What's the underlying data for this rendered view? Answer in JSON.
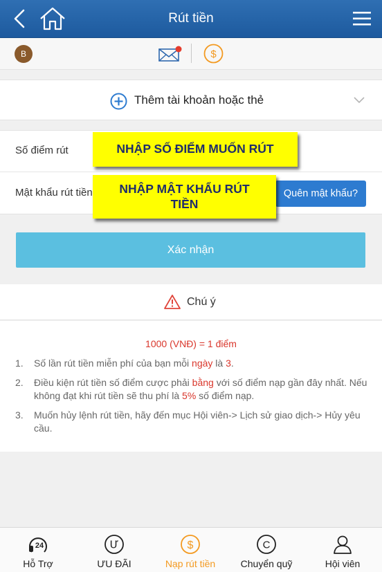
{
  "header": {
    "title": "Rút tiền"
  },
  "user": {
    "avatar_letter": "B"
  },
  "add_account": {
    "label": "Thêm tài khoản hoặc thẻ"
  },
  "form": {
    "points_label": "Số điểm rút",
    "points_value": "",
    "password_label": "Mật khẩu rút tiền",
    "password_value": "",
    "forgot_label": "Quên mật khẩu?"
  },
  "annotations": {
    "points_note": "NHẬP SỐ ĐIỂM MUỐN RÚT",
    "password_note_line1": "NHẬP MẬT KHẨU RÚT",
    "password_note_line2": "TIỀN"
  },
  "confirm": {
    "label": "Xác nhận"
  },
  "notice": {
    "title": "Chú ý",
    "rate": "1000 (VNĐ) = 1 điểm",
    "rules": [
      {
        "num": "1.",
        "p1": "Số lần rút tiền miễn phí của bạn mỗi ",
        "h1": "ngày",
        "p2": " là ",
        "h2": "3",
        "p3": "."
      },
      {
        "num": "2.",
        "p1": "Điều kiện rút tiền số điểm cược phải ",
        "h1": "bằng",
        "p2": " với số điểm nạp gần đây nhất. Nếu không đạt khi rút tiền sẽ thu phí là ",
        "h2": "5%",
        "p3": " số điểm nạp."
      },
      {
        "num": "3.",
        "p1": "Muốn hủy lệnh rút tiền, hãy đến mục Hội viên-> Lịch sử giao dịch-> Hủy yêu cầu."
      }
    ]
  },
  "tabs": [
    {
      "label": "Hỗ Trợ",
      "icon": "support-24-icon"
    },
    {
      "label": "ƯU ĐÃI",
      "icon": "promotion-icon"
    },
    {
      "label": "Nạp rút tiền",
      "icon": "deposit-withdraw-icon",
      "active": true
    },
    {
      "label": "Chuyển quỹ",
      "icon": "transfer-icon"
    },
    {
      "label": "Hội viên",
      "icon": "member-icon"
    }
  ],
  "colors": {
    "header": "#2f6fb3",
    "accent": "#5bbfe0",
    "button_blue": "#2d7bd0",
    "highlight_red": "#d9362b",
    "active_tab": "#f39a21",
    "note_yellow": "#ffff00"
  }
}
